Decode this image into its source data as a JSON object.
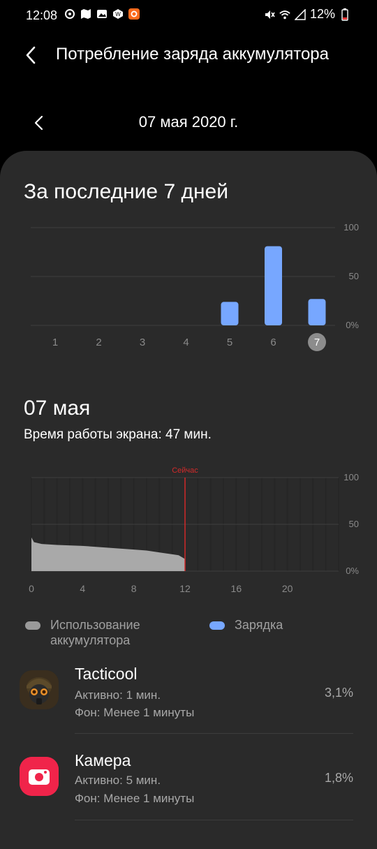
{
  "status_bar": {
    "time": "12:08",
    "battery": "12%",
    "left_icons": [
      "location-icon",
      "maps-icon",
      "gallery-icon",
      "w-app-icon",
      "m-app-icon"
    ],
    "right_icons": [
      "mute-icon",
      "wifi-icon",
      "signal-icon",
      "battery-icon"
    ]
  },
  "header": {
    "title": "Потребление заряда аккумулятора"
  },
  "date_nav": {
    "label": "07 мая 2020 г."
  },
  "weekly": {
    "title": "За последние 7 дней",
    "y_ticks": [
      "100",
      "50",
      "0%"
    ],
    "day_labels": [
      "1",
      "2",
      "3",
      "4",
      "5",
      "6",
      "7"
    ]
  },
  "daily": {
    "title": "07 мая",
    "screen_time": "Время работы экрана: 47 мин.",
    "now_label": "Сейчас",
    "y_ticks": [
      "100",
      "50",
      "0%"
    ],
    "x_ticks": [
      "0",
      "4",
      "8",
      "12",
      "16",
      "20"
    ]
  },
  "legend": {
    "usage": "Использование аккумулятора",
    "usage_line1": "Использование",
    "usage_line2": "аккумулятора",
    "charging": "Зарядка"
  },
  "apps": [
    {
      "name": "Tacticool",
      "active": "Активно: 1 мин.",
      "background": "Фон: Менее 1 минуты",
      "percent": "3,1%"
    },
    {
      "name": "Камера",
      "active": "Активно: 5 мин.",
      "background": "Фон: Менее 1 минуты",
      "percent": "1,8%"
    }
  ],
  "colors": {
    "bar": "#77a7ff",
    "usage_fill": "#a9a9a9",
    "now_line": "#d12a2a",
    "card_bg": "#2a2a2a",
    "camera_icon": "#f0244a"
  },
  "chart_data": [
    {
      "type": "bar",
      "title": "За последние 7 дней",
      "categories": [
        "1",
        "2",
        "3",
        "4",
        "5",
        "6",
        "7"
      ],
      "values": [
        0,
        0,
        0,
        0,
        24,
        81,
        27
      ],
      "ylim": [
        0,
        100
      ],
      "selected": "7"
    },
    {
      "type": "area",
      "title": "07 мая",
      "x": [
        0,
        0.2,
        0.8,
        2,
        4,
        6,
        8,
        9,
        10,
        11,
        11.5,
        12
      ],
      "y": [
        36,
        31,
        29,
        28,
        27,
        25,
        23,
        22,
        20,
        18,
        17,
        13
      ],
      "xlim": [
        0,
        24
      ],
      "ylim": [
        0,
        100
      ],
      "now_x": 12
    }
  ]
}
